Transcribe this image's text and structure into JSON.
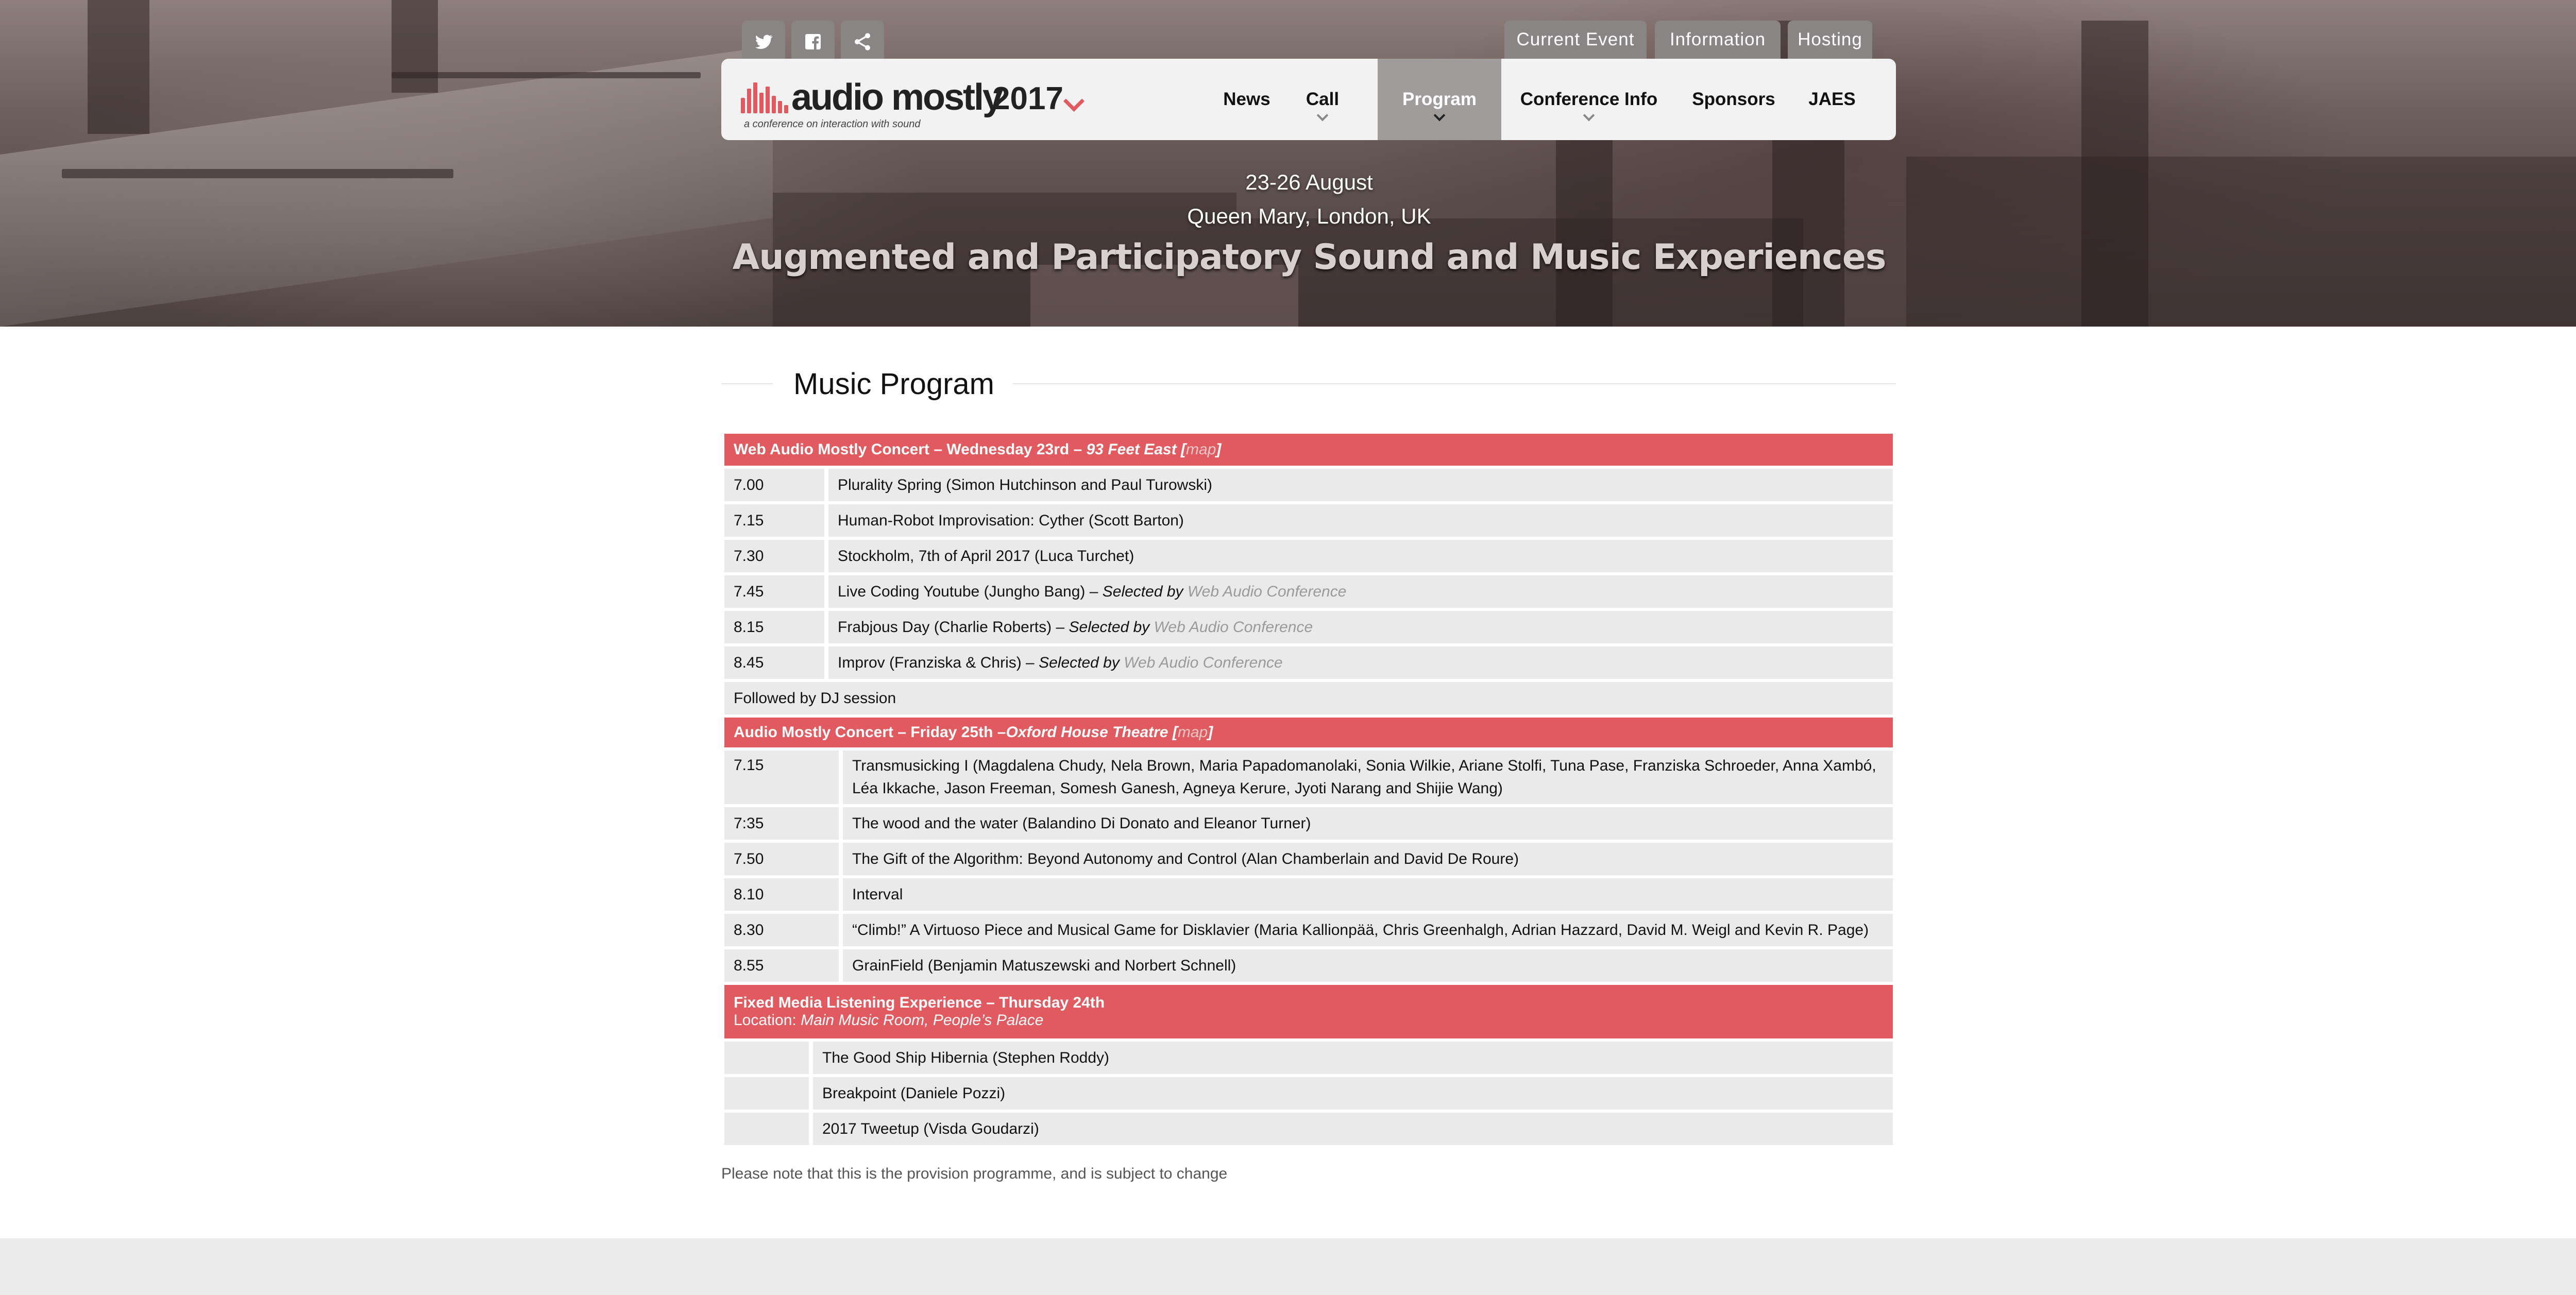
{
  "social": [
    {
      "name": "twitter-icon"
    },
    {
      "name": "facebook-icon"
    },
    {
      "name": "share-icon"
    }
  ],
  "top_tabs": [
    "Current Event",
    "Information",
    "Hosting"
  ],
  "logo": {
    "text": "audio mostly",
    "year": "2017",
    "tagline": "a conference on interaction with sound"
  },
  "nav": [
    "News",
    "Call",
    "Program",
    "Conference Info",
    "Sponsors",
    "JAES"
  ],
  "hero": {
    "date": "23-26 August",
    "location": "Queen Mary, London, UK",
    "title": "Augmented and Participatory Sound and Music Experiences"
  },
  "section_title": "Music Program",
  "concert1": {
    "header_main": "Web Audio Mostly Concert – Wednesday 23rd – ",
    "header_venue": "93 Feet East",
    "header_open": " [",
    "header_link": "map",
    "header_close": "]",
    "rows": [
      {
        "time": "7.00",
        "title": "Plurality Spring (Simon Hutchinson and Paul Turowski)"
      },
      {
        "time": "7.15",
        "title": "Human-Robot Improvisation: Cyther (Scott Barton)"
      },
      {
        "time": "7.30",
        "title": "Stockholm, 7th of April 2017 (Luca Turchet)"
      },
      {
        "time": "7.45",
        "title": "Live Coding Youtube (Jungho Bang) – ",
        "sel": "Selected by ",
        "link": "Web Audio Conference"
      },
      {
        "time": "8.15",
        "title": "Frabjous Day (Charlie Roberts) – ",
        "sel": "Selected by ",
        "link": "Web Audio Conference"
      },
      {
        "time": "8.45",
        "title": "Improv (Franziska & Chris) – ",
        "sel": "Selected by ",
        "link": "Web Audio Conference"
      }
    ],
    "footer_row": "Followed by DJ session"
  },
  "concert2": {
    "header_main": "Audio Mostly Concert – Friday 25th –",
    "header_venue": "Oxford House Theatre",
    "header_open": " [",
    "header_link": "map",
    "header_close": "]",
    "rows": [
      {
        "time": "7.15",
        "title": "Transmusicking I (Magdalena Chudy, Nela Brown, Maria Papadomanolaki, Sonia Wilkie, Ariane Stolfi, Tuna Pase, Franziska Schroeder, Anna Xambó, Léa Ikkache, Jason Freeman, Somesh Ganesh, Agneya Kerure, Jyoti Narang and Shijie Wang)"
      },
      {
        "time": "7:35",
        "title": "The wood and the water (Balandino Di Donato and Eleanor Turner)"
      },
      {
        "time": "7.50",
        "title": "The Gift of the Algorithm: Beyond Autonomy and Control (Alan Chamberlain and David De Roure)"
      },
      {
        "time": "8.10",
        "title": "Interval"
      },
      {
        "time": "8.30",
        "title": "“Climb!” A Virtuoso Piece and Musical Game for Disklavier (Maria Kallionpää, Chris Greenhalgh, Adrian Hazzard, David M. Weigl and Kevin R. Page)"
      },
      {
        "time": "8.55",
        "title": "GrainField (Benjamin Matuszewski and Norbert Schnell)"
      }
    ]
  },
  "fixed": {
    "header_main": "Fixed Media Listening Experience – Thursday 24th",
    "location_label": "Location: ",
    "location_value": "Main Music Room, People’s Palace",
    "rows": [
      {
        "title": "The Good Ship Hibernia (Stephen Roddy)"
      },
      {
        "title": "Breakpoint (Daniele Pozzi)"
      },
      {
        "title": "2017 Tweetup (Visda Goudarzi)"
      }
    ]
  },
  "note": "Please note that this is the provision programme, and is subject to change",
  "colors": {
    "accent": "#e05a5f",
    "row_bg": "#eaeaea",
    "nav_active": "#a09c9c"
  }
}
